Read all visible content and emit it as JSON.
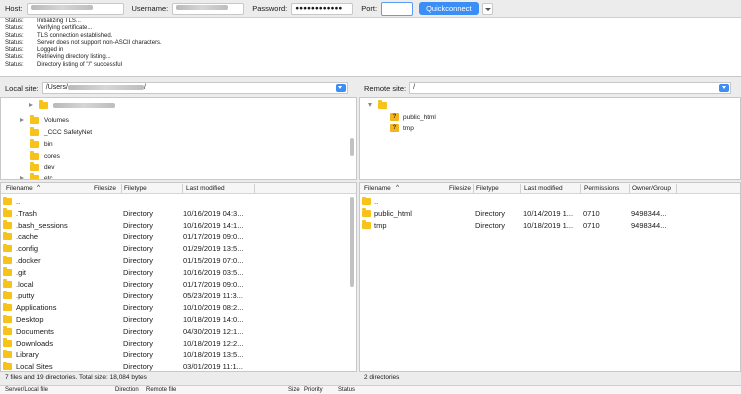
{
  "quickconnect": {
    "host_label": "Host:",
    "username_label": "Username:",
    "password_label": "Password:",
    "password_value": "●●●●●●●●●●●●",
    "port_label": "Port:",
    "port_value": "",
    "button_label": "Quickconnect"
  },
  "log": [
    {
      "k": "Status:",
      "v": "Initializing TLS..."
    },
    {
      "k": "Status:",
      "v": "Verifying certificate..."
    },
    {
      "k": "Status:",
      "v": "TLS connection established."
    },
    {
      "k": "Status:",
      "v": "Server does not support non-ASCII characters."
    },
    {
      "k": "Status:",
      "v": "Logged in"
    },
    {
      "k": "Status:",
      "v": "Retrieving directory listing..."
    },
    {
      "k": "Status:",
      "v": "Directory listing of \"/\" successful"
    }
  ],
  "local": {
    "label": "Local site:",
    "path_prefix": "/Users/",
    "path_suffix": "/",
    "tree": [
      "Volumes",
      "_CCC SafetyNet",
      "bin",
      "cores",
      "dev",
      "etc"
    ],
    "headers": {
      "name": "Filename",
      "size": "Filesize",
      "type": "Filetype",
      "modified": "Last modified"
    },
    "files": [
      {
        "name": "..",
        "type": "",
        "modified": ""
      },
      {
        "name": ".Trash",
        "type": "Directory",
        "modified": "10/16/2019 04:3..."
      },
      {
        "name": ".bash_sessions",
        "type": "Directory",
        "modified": "10/16/2019 14:1..."
      },
      {
        "name": ".cache",
        "type": "Directory",
        "modified": "01/17/2019 09:0..."
      },
      {
        "name": ".config",
        "type": "Directory",
        "modified": "01/29/2019 13:5..."
      },
      {
        "name": ".docker",
        "type": "Directory",
        "modified": "01/15/2019 07:0..."
      },
      {
        "name": ".git",
        "type": "Directory",
        "modified": "10/16/2019 03:5..."
      },
      {
        "name": ".local",
        "type": "Directory",
        "modified": "01/17/2019 09:0..."
      },
      {
        "name": ".putty",
        "type": "Directory",
        "modified": "05/23/2019 11:3..."
      },
      {
        "name": "Applications",
        "type": "Directory",
        "modified": "10/10/2019 08:2..."
      },
      {
        "name": "Desktop",
        "type": "Directory",
        "modified": "10/18/2019 14:0..."
      },
      {
        "name": "Documents",
        "type": "Directory",
        "modified": "04/30/2019 12:1..."
      },
      {
        "name": "Downloads",
        "type": "Directory",
        "modified": "10/18/2019 12:2..."
      },
      {
        "name": "Library",
        "type": "Directory",
        "modified": "10/18/2019 13:5..."
      },
      {
        "name": "Local Sites",
        "type": "Directory",
        "modified": "03/01/2019 11:1..."
      }
    ],
    "status": "7 files and 19 directories. Total size: 18,084 bytes"
  },
  "remote": {
    "label": "Remote site:",
    "path": "/",
    "tree": [
      "public_html",
      "tmp"
    ],
    "headers": {
      "name": "Filename",
      "size": "Filesize",
      "type": "Filetype",
      "modified": "Last modified",
      "perms": "Permissions",
      "owner": "Owner/Group"
    },
    "files": [
      {
        "name": "..",
        "type": "",
        "modified": "",
        "perms": "",
        "owner": ""
      },
      {
        "name": "public_html",
        "type": "Directory",
        "modified": "10/14/2019 1...",
        "perms": "0710",
        "owner": "9498344..."
      },
      {
        "name": "tmp",
        "type": "Directory",
        "modified": "10/18/2019 1...",
        "perms": "0710",
        "owner": "9498344..."
      }
    ],
    "status": "2 directories"
  },
  "queue": {
    "server_local": "Server/Local file",
    "direction": "Direction",
    "remote_file": "Remote file",
    "size": "Size",
    "priority": "Priority",
    "status": "Status"
  },
  "colors": {
    "accent": "#3b8ef5",
    "folder": "#f7c21a"
  }
}
